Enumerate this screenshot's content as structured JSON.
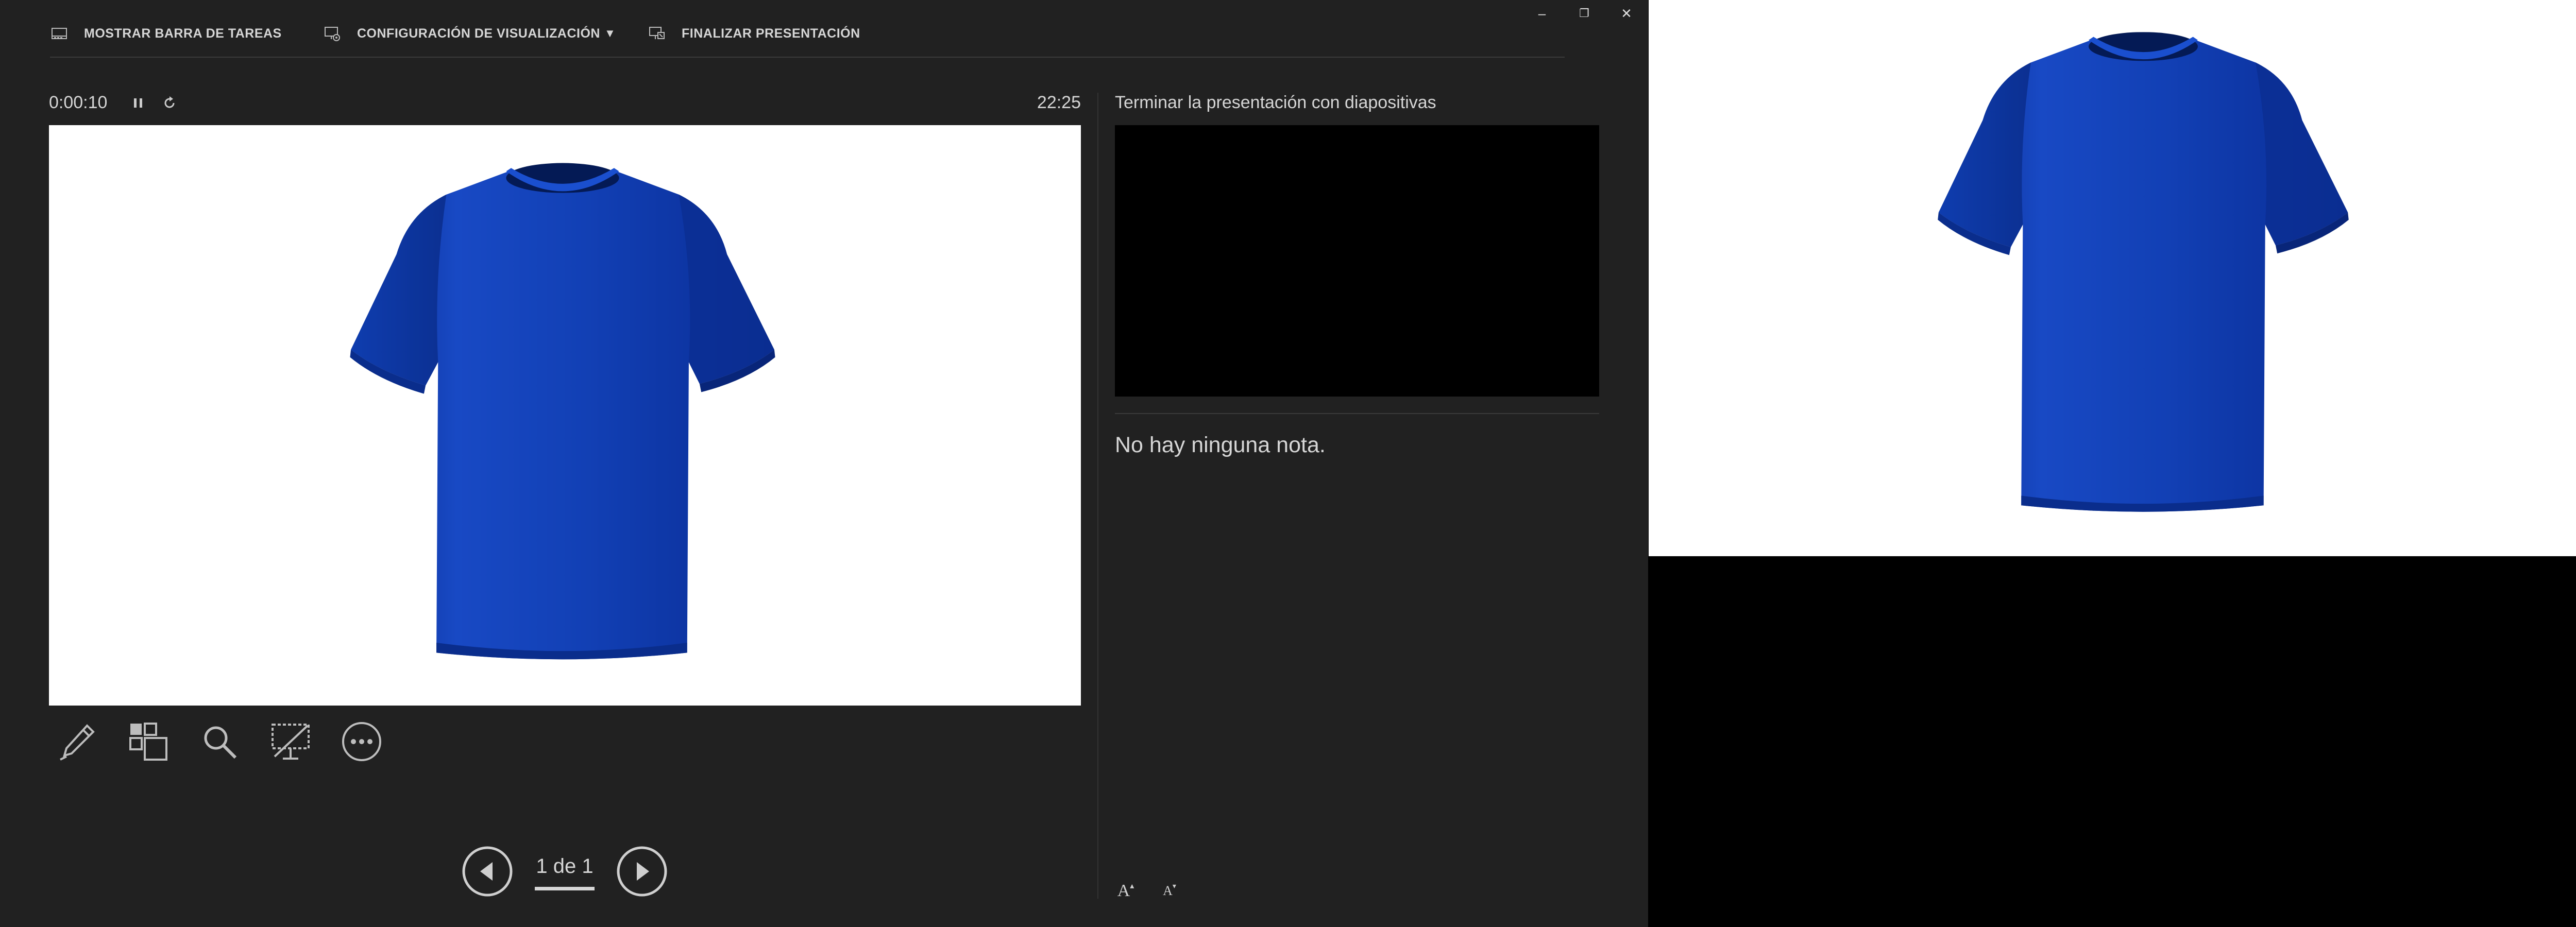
{
  "toolbar": {
    "show_taskbar_label": "MOSTRAR BARRA DE TAREAS",
    "display_settings_label": "CONFIGURACIÓN DE VISUALIZACIÓN",
    "display_settings_arrow": "▼",
    "end_show_label": "FINALIZAR PRESENTACIÓN"
  },
  "window_controls": {
    "minimize": "–",
    "restore": "❐",
    "close": "✕"
  },
  "timer": {
    "elapsed": "0:00:10",
    "clock": "22:25"
  },
  "navigation": {
    "page_indicator": "1 de 1"
  },
  "notes_panel": {
    "next_slide_title": "Terminar la presentación con diapositivas",
    "notes_text": "No hay ninguna nota.",
    "increase_font": "A",
    "decrease_font": "A"
  },
  "icons": {
    "taskbar": "taskbar-icon",
    "display_settings": "monitor-gear-icon",
    "end_show": "end-show-icon",
    "pause": "pause-icon",
    "restart": "restart-icon",
    "pen": "pen-icon",
    "all_slides": "grid-icon",
    "zoom": "magnifier-icon",
    "black_screen": "screen-slash-icon",
    "more": "more-icon",
    "prev": "prev-arrow-icon",
    "next": "next-arrow-icon"
  },
  "colors": {
    "presenter_bg": "#212121",
    "shirt_blue": "#1040b8",
    "text": "#d6d6d6"
  }
}
